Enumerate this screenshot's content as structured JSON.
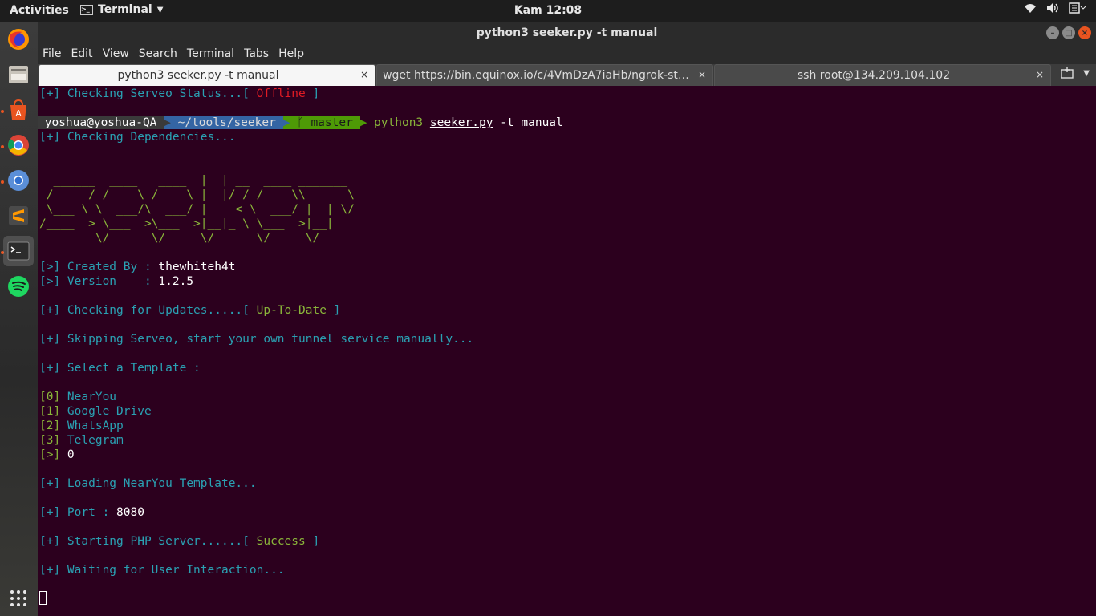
{
  "topbar": {
    "activities": "Activities",
    "app_menu": "Terminal",
    "clock": "Kam 12:08"
  },
  "window": {
    "title": "python3 seeker.py -t manual"
  },
  "menu": [
    "File",
    "Edit",
    "View",
    "Search",
    "Terminal",
    "Tabs",
    "Help"
  ],
  "tabs": [
    {
      "label": "python3 seeker.py -t manual",
      "close": "×"
    },
    {
      "label": "wget https://bin.equinox.io/c/4VmDzA7iaHb/ngrok-st…",
      "close": "×"
    },
    {
      "label": "ssh root@134.209.104.102",
      "close": "×"
    }
  ],
  "terminal": {
    "serveo_prefix": "[+] Checking Serveo Status...[ ",
    "serveo_status": "Offline",
    "serveo_suffix": " ]",
    "prompt_user": " yoshua@yoshua-QA ",
    "prompt_path": " ~/tools/seeker ",
    "prompt_branch": " ᚴ master ",
    "cmd_python": "python3",
    "cmd_script": "seeker.py",
    "cmd_args": " -t manual",
    "checking_deps": "[+] Checking Dependencies...",
    "ascii": [
      "                        __",
      "  ______  ____   ____  |  | __  ____ _______",
      " /  ___/_/ __ \\_/ __ \\ |  |/ /_/ __ \\\\_  __ \\",
      " \\___ \\ \\  ___/\\  ___/ |    < \\  ___/ |  | \\/",
      "/____  > \\___  >\\___  >|__|_ \\ \\___  >|__|",
      "        \\/      \\/     \\/      \\/     \\/"
    ],
    "created_by_label": "[>] Created By : ",
    "created_by_value": "thewhiteh4t",
    "version_label": "[>] Version    : ",
    "version_value": "1.2.5",
    "updates_prefix": "[+] Checking for Updates.....[ ",
    "updates_status": "Up-To-Date",
    "updates_suffix": " ]",
    "skipping": "[+] Skipping Serveo, start your own tunnel service manually...",
    "select_template": "[+] Select a Template :",
    "templates": [
      {
        "index": "[0] ",
        "name": "NearYou"
      },
      {
        "index": "[1] ",
        "name": "Google Drive"
      },
      {
        "index": "[2] ",
        "name": "WhatsApp"
      },
      {
        "index": "[3] ",
        "name": "Telegram"
      }
    ],
    "choice_prompt": "[>] ",
    "choice_value": "0",
    "loading": "[+] Loading NearYou Template...",
    "port_label": "[+] Port : ",
    "port_value": "8080",
    "php_prefix": "[+] Starting PHP Server......[ ",
    "php_status": "Success",
    "php_suffix": " ]",
    "waiting": "[+] Waiting for User Interaction..."
  },
  "icons": [
    "firefox-icon",
    "files-icon",
    "software-icon",
    "chrome-icon",
    "chromium-icon",
    "sublime-icon",
    "terminal-icon",
    "spotify-icon",
    "apps-grid-icon",
    "wifi-icon",
    "volume-icon",
    "system-menu-icon"
  ],
  "colors": {
    "terminal_bg": "#2c001e",
    "green": "#8ab53a",
    "cyan": "#2aa1b3",
    "red": "#e01b24",
    "accent": "#e95420"
  }
}
